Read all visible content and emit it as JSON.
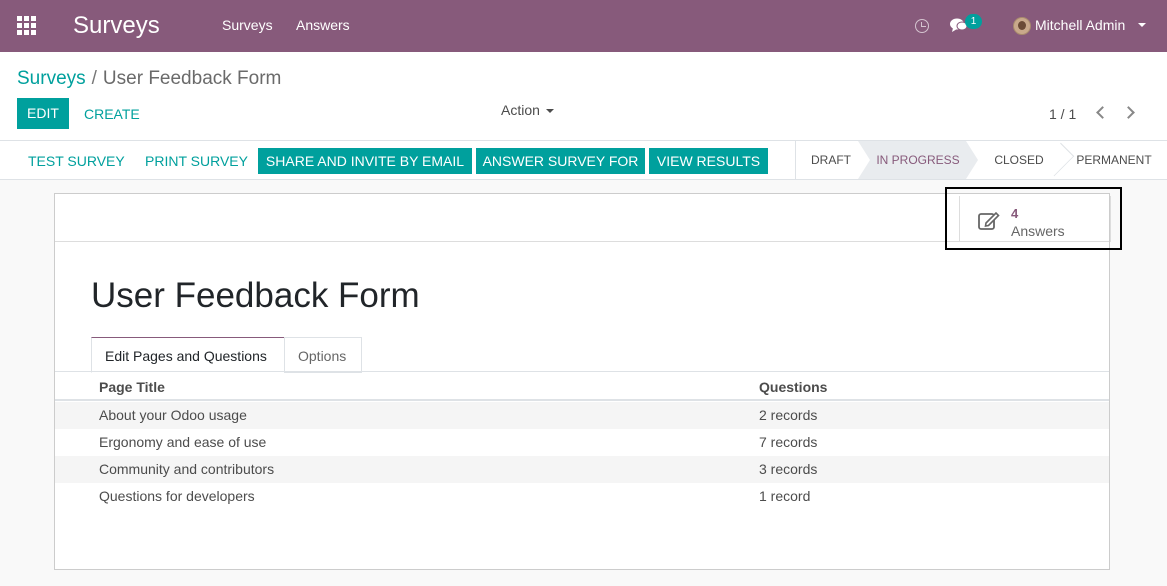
{
  "navbar": {
    "app_title": "Surveys",
    "menu": [
      "Surveys",
      "Answers"
    ],
    "chat_count": "1",
    "user_name": "Mitchell Admin",
    "bg_color": "#875a7b"
  },
  "control_panel": {
    "breadcrumb": {
      "root": "Surveys",
      "separator": "/",
      "current": "User Feedback Form"
    },
    "edit_label": "EDIT",
    "create_label": "CREATE",
    "action_label": "Action",
    "pager": "1 / 1"
  },
  "statusbar": {
    "test_survey": "TEST SURVEY",
    "print_survey": "PRINT SURVEY",
    "share": "SHARE AND INVITE BY EMAIL",
    "answer": "ANSWER SURVEY FOR",
    "results": "VIEW RESULTS",
    "stages": [
      "DRAFT",
      "IN PROGRESS",
      "CLOSED",
      "PERMANENT"
    ],
    "active_stage": "IN PROGRESS",
    "accent_color": "#00a09d"
  },
  "form": {
    "stat_button": {
      "value": "4",
      "label": "Answers",
      "icon": "edit-icon"
    },
    "title": "User Feedback Form",
    "tabs": [
      "Edit Pages and Questions",
      "Options"
    ],
    "table": {
      "columns": [
        "Page Title",
        "Questions"
      ],
      "rows": [
        {
          "title": "About your Odoo usage",
          "questions": "2 records"
        },
        {
          "title": "Ergonomy and ease of use",
          "questions": "7 records"
        },
        {
          "title": "Community and contributors",
          "questions": "3 records"
        },
        {
          "title": "Questions for developers",
          "questions": "1 record"
        }
      ]
    }
  }
}
